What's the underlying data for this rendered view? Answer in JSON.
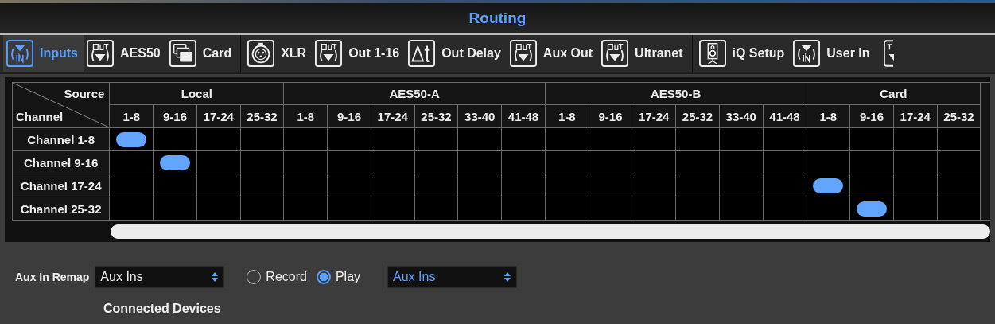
{
  "window": {
    "title": "Routing"
  },
  "tab_groups": [
    [
      {
        "label": "Inputs",
        "kind": "in",
        "selected": true
      },
      {
        "label": "AES50",
        "kind": "out",
        "selected": false
      },
      {
        "label": "Card",
        "kind": "card",
        "selected": false
      }
    ],
    [
      {
        "label": "XLR",
        "kind": "xlr",
        "selected": false
      },
      {
        "label": "Out 1-16",
        "kind": "out",
        "selected": false
      },
      {
        "label": "Out Delay",
        "kind": "delta",
        "selected": false
      },
      {
        "label": "Aux Out",
        "kind": "out",
        "selected": false
      },
      {
        "label": "Ultranet",
        "kind": "out",
        "selected": false
      }
    ],
    [
      {
        "label": "iQ Setup",
        "kind": "speaker",
        "selected": false
      },
      {
        "label": "User In",
        "kind": "in",
        "selected": false
      }
    ]
  ],
  "matrix": {
    "source_label": "Source",
    "channel_label": "Channel",
    "groups": [
      {
        "name": "Local",
        "columns": [
          "1-8",
          "9-16",
          "17-24",
          "25-32"
        ]
      },
      {
        "name": "AES50-A",
        "columns": [
          "1-8",
          "9-16",
          "17-24",
          "25-32",
          "33-40",
          "41-48"
        ]
      },
      {
        "name": "AES50-B",
        "columns": [
          "1-8",
          "9-16",
          "17-24",
          "25-32",
          "33-40",
          "41-48"
        ]
      },
      {
        "name": "Card",
        "columns": [
          "1-8",
          "9-16",
          "17-24",
          "25-32"
        ]
      }
    ],
    "rows": [
      {
        "label": "Channel 1-8",
        "cells": [
          true,
          false,
          false,
          false,
          false,
          false,
          false,
          false,
          false,
          false,
          false,
          false,
          false,
          false,
          false,
          false,
          false,
          false,
          false,
          false
        ]
      },
      {
        "label": "Channel 9-16",
        "cells": [
          false,
          true,
          false,
          false,
          false,
          false,
          false,
          false,
          false,
          false,
          false,
          false,
          false,
          false,
          false,
          false,
          false,
          false,
          false,
          false
        ]
      },
      {
        "label": "Channel 17-24",
        "cells": [
          false,
          false,
          false,
          false,
          false,
          false,
          false,
          false,
          false,
          false,
          false,
          false,
          false,
          false,
          false,
          false,
          true,
          false,
          false,
          false
        ]
      },
      {
        "label": "Channel 25-32",
        "cells": [
          false,
          false,
          false,
          false,
          false,
          false,
          false,
          false,
          false,
          false,
          false,
          false,
          false,
          false,
          false,
          false,
          false,
          true,
          false,
          false
        ]
      }
    ]
  },
  "aux_in_remap": {
    "label": "Aux In Remap",
    "value": "Aux Ins",
    "modes": [
      {
        "label": "Record",
        "selected": false
      },
      {
        "label": "Play",
        "selected": true
      }
    ],
    "target": "Aux Ins"
  },
  "connected_devices": {
    "title": "Connected Devices"
  }
}
